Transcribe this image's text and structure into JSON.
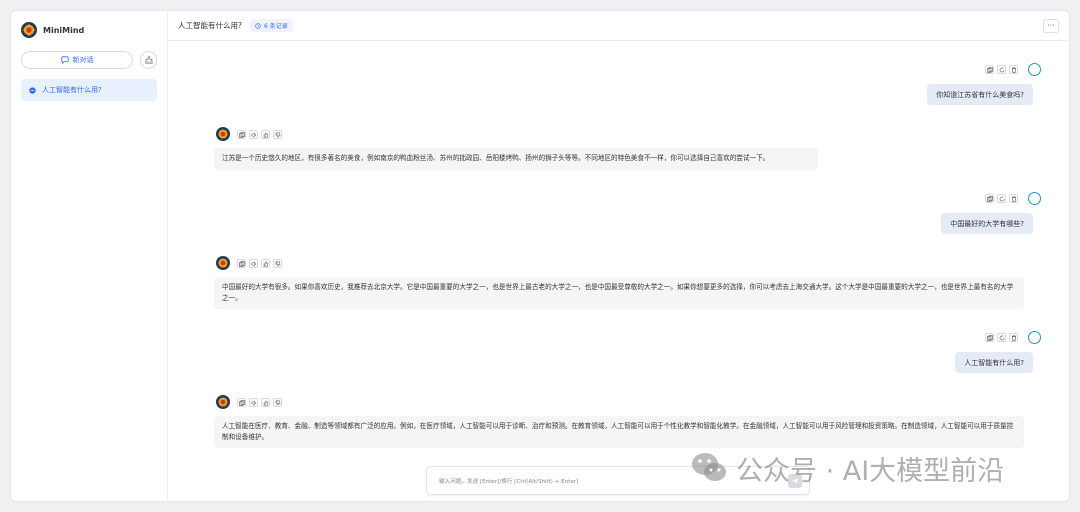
{
  "app": {
    "name": "MiniMind"
  },
  "sidebar": {
    "new_chat_label": "新对话",
    "conversations": [
      {
        "title": "人工智能有什么用?"
      }
    ]
  },
  "header": {
    "title": "人工智能有什么用?",
    "record_badge": "6 条记录",
    "more_label": "···"
  },
  "messages": [
    {
      "role": "user",
      "text": "你知道江苏省有什么美食吗?"
    },
    {
      "role": "assistant",
      "text": "江苏是一个历史悠久的地区，有很多著名的美食，例如南京的鸭血粉丝汤、苏州的拙政园、岳阳楼烤鸭、扬州的狮子头等等。不同地区的特色美食不一样，你可以选择自己喜欢的尝试一下。"
    },
    {
      "role": "user",
      "text": "中国最好的大学有哪些?"
    },
    {
      "role": "assistant",
      "text": "中国最好的大学有很多。如果你喜欢历史，我推荐去北京大学。它是中国最重要的大学之一，也是世界上最古老的大学之一，也是中国最受尊敬的大学之一。如果你想要更多的选择，你可以考虑去上海交通大学。这个大学是中国最重要的大学之一，也是世界上最有名的大学之一。"
    },
    {
      "role": "user",
      "text": "人工智能有什么用?"
    },
    {
      "role": "assistant",
      "text": "人工智能在医疗、教育、金融、制造等领域都有广泛的应用。例如，在医疗领域，人工智能可以用于诊断、治疗和预测。在教育领域，人工智能可以用于个性化教学和智能化教学。在金融领域，人工智能可以用于风险管理和投资策略。在制造领域，人工智能可以用于质量控制和设备维护。"
    }
  ],
  "input": {
    "placeholder": "输入问题。发送 [Enter]/换行 [Ctrl(Alt/Shift) + Enter]"
  },
  "watermark": {
    "text": "公众号 · AI大模型前沿"
  },
  "colors": {
    "accent": "#2f6bff",
    "user_bubble": "#e4ebf7",
    "bot_bubble": "#f4f5f7",
    "user_avatar": "#1e95d4"
  }
}
